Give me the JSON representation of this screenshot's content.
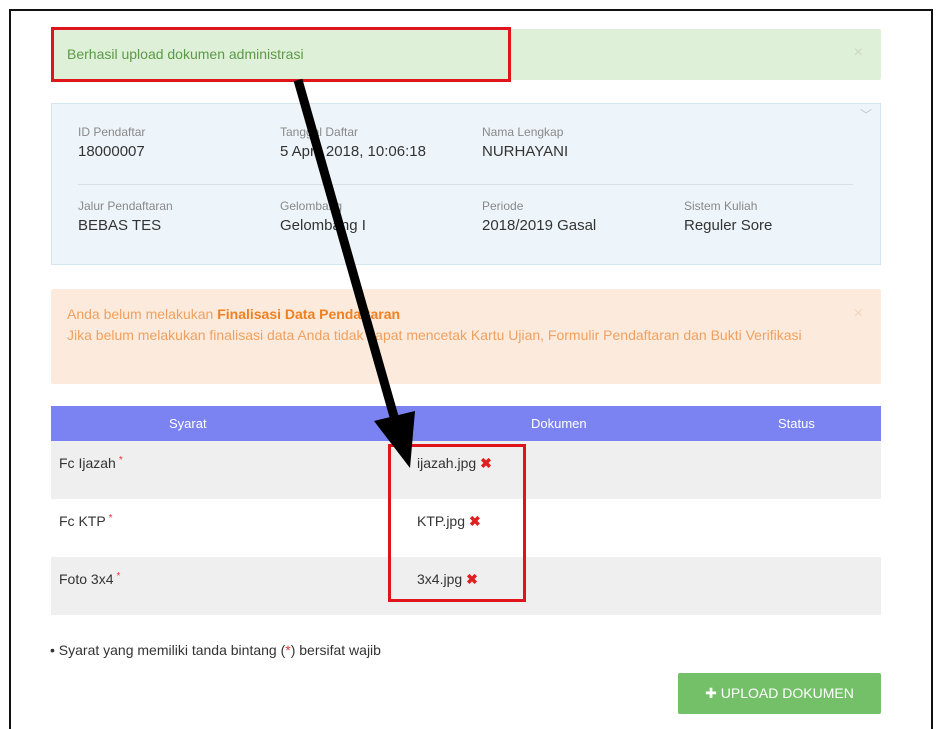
{
  "success_alert": {
    "message": "Berhasil upload dokumen administrasi",
    "close": "×"
  },
  "info": {
    "chevron": "﹀",
    "fields": [
      {
        "label": "ID Pendaftar",
        "value": "18000007"
      },
      {
        "label": "Tanggal Daftar",
        "value": "5 April 2018, 10:06:18"
      },
      {
        "label": "Nama Lengkap",
        "value": "NURHAYANI"
      },
      {
        "label": "Jalur Pendaftaran",
        "value": "BEBAS TES"
      },
      {
        "label": "Gelombang",
        "value": "Gelombang I"
      },
      {
        "label": "Periode",
        "value": "2018/2019 Gasal"
      },
      {
        "label": "Sistem Kuliah",
        "value": "Reguler Sore"
      }
    ]
  },
  "warning_alert": {
    "prefix": "Anda belum melakukan ",
    "bold": "Finalisasi Data Pendaftaran",
    "line2": "Jika belum melakukan finalisasi data Anda tidak dapat mencetak Kartu Ujian, Formulir Pendaftaran dan Bukti Verifikasi",
    "close": "×"
  },
  "table": {
    "headers": {
      "syarat": "Syarat",
      "dokumen": "Dokumen",
      "status": "Status"
    },
    "rows": [
      {
        "syarat": "Fc Ijazah",
        "star": "*",
        "dokumen": "ijazah.jpg",
        "delete": "✖"
      },
      {
        "syarat": "Fc KTP",
        "star": "*",
        "dokumen": "KTP.jpg",
        "delete": "✖"
      },
      {
        "syarat": "Foto 3x4",
        "star": "*",
        "dokumen": "3x4.jpg",
        "delete": "✖"
      }
    ]
  },
  "note": {
    "bullet": "•",
    "before": "Syarat yang memiliki tanda bintang (",
    "star": "*",
    "after": ") bersifat wajib"
  },
  "upload_button": {
    "label": "✚ UPLOAD DOKUMEN"
  },
  "colors": {
    "annotation_red": "#e0141b",
    "annotation_arrow": "#000000",
    "header_purple": "#7b83f3",
    "button_green": "#74c069"
  }
}
